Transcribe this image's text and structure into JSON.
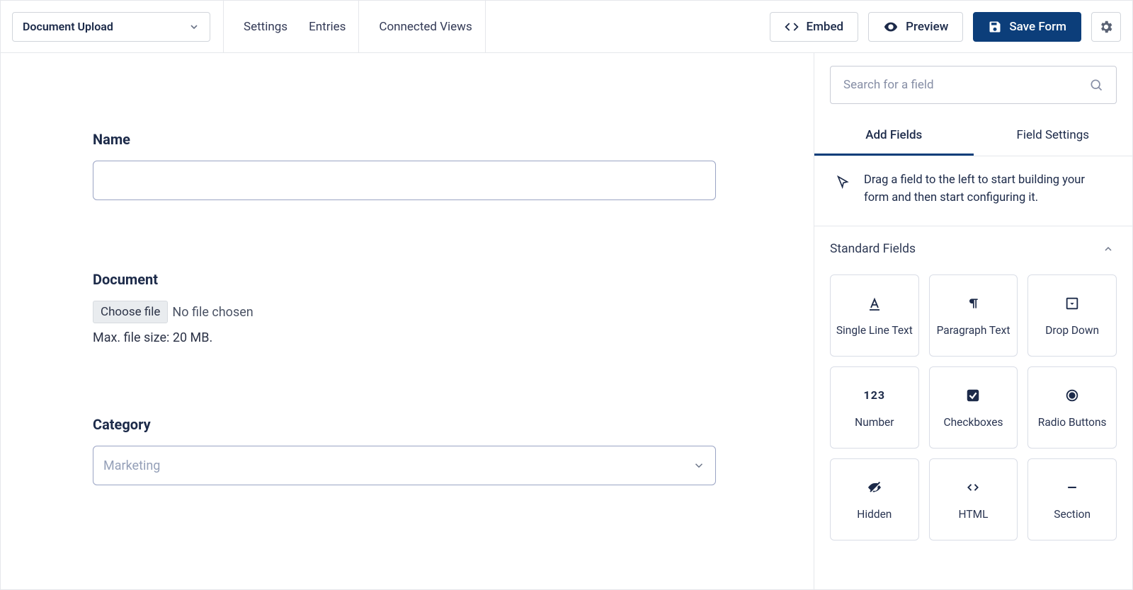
{
  "header": {
    "form_name": "Document Upload",
    "nav": {
      "settings": "Settings",
      "entries": "Entries",
      "connected_views": "Connected Views"
    },
    "buttons": {
      "embed": "Embed",
      "preview": "Preview",
      "save": "Save Form"
    }
  },
  "form": {
    "fields": [
      {
        "label": "Name"
      },
      {
        "label": "Document",
        "choose_label": "Choose file",
        "no_file": "No file chosen",
        "hint": "Max. file size: 20 MB."
      },
      {
        "label": "Category",
        "placeholder": "Marketing"
      }
    ]
  },
  "sidebar": {
    "search_placeholder": "Search for a field",
    "tabs": {
      "add": "Add Fields",
      "settings": "Field Settings"
    },
    "hint": "Drag a field to the left to start building your form and then start configuring it.",
    "section_title": "Standard Fields",
    "field_types": [
      "Single Line Text",
      "Paragraph Text",
      "Drop Down",
      "Number",
      "Checkboxes",
      "Radio Buttons",
      "Hidden",
      "HTML",
      "Section"
    ]
  }
}
